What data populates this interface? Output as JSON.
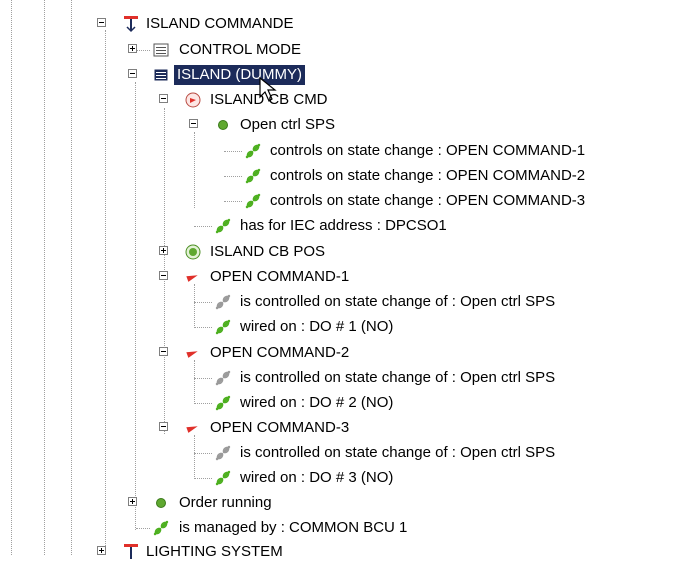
{
  "tree": {
    "nodes": [
      {
        "label": "ISLAND COMMANDE",
        "icon": "red-t-function-icon"
      },
      {
        "label": "CONTROL MODE",
        "icon": "list-icon"
      },
      {
        "label": "ISLAND  (DUMMY)",
        "icon": "list-icon",
        "selected": true
      },
      {
        "label": "ISLAND CB CMD",
        "icon": "red-circle-icon"
      },
      {
        "label": "Open ctrl SPS",
        "icon": "green-dot-icon"
      },
      {
        "label": "controls on state change : OPEN COMMAND-1",
        "icon": "green-link-icon"
      },
      {
        "label": "controls on state change : OPEN COMMAND-2",
        "icon": "green-link-icon"
      },
      {
        "label": "controls on state change : OPEN COMMAND-3",
        "icon": "green-link-icon"
      },
      {
        "label": "has for IEC address : DPCSO1",
        "icon": "green-link-icon"
      },
      {
        "label": "ISLAND CB POS",
        "icon": "green-ring-icon"
      },
      {
        "label": "OPEN COMMAND-1",
        "icon": "red-arrow-icon"
      },
      {
        "label": "is controlled on state change of : Open ctrl SPS",
        "icon": "gray-link-icon"
      },
      {
        "label": "wired on : DO # 1 (NO)",
        "icon": "green-link-icon"
      },
      {
        "label": "OPEN COMMAND-2",
        "icon": "red-arrow-icon"
      },
      {
        "label": "is controlled on state change of : Open ctrl SPS",
        "icon": "gray-link-icon"
      },
      {
        "label": "wired on : DO # 2 (NO)",
        "icon": "green-link-icon"
      },
      {
        "label": "OPEN COMMAND-3",
        "icon": "red-arrow-icon"
      },
      {
        "label": "is controlled on state change of : Open ctrl SPS",
        "icon": "gray-link-icon"
      },
      {
        "label": "wired on : DO # 3 (NO)",
        "icon": "green-link-icon"
      },
      {
        "label": "Order running",
        "icon": "green-dot-icon"
      },
      {
        "label": "is managed by : COMMON BCU 1",
        "icon": "green-link-icon"
      },
      {
        "label": "LIGHTING SYSTEM",
        "icon": "red-t-function-icon"
      }
    ]
  },
  "colors": {
    "selection_bg": "#1c2b5a",
    "tree_lines": "#a0a0a0",
    "link_green": "#4caf1e",
    "accent_red": "#e0302a"
  }
}
